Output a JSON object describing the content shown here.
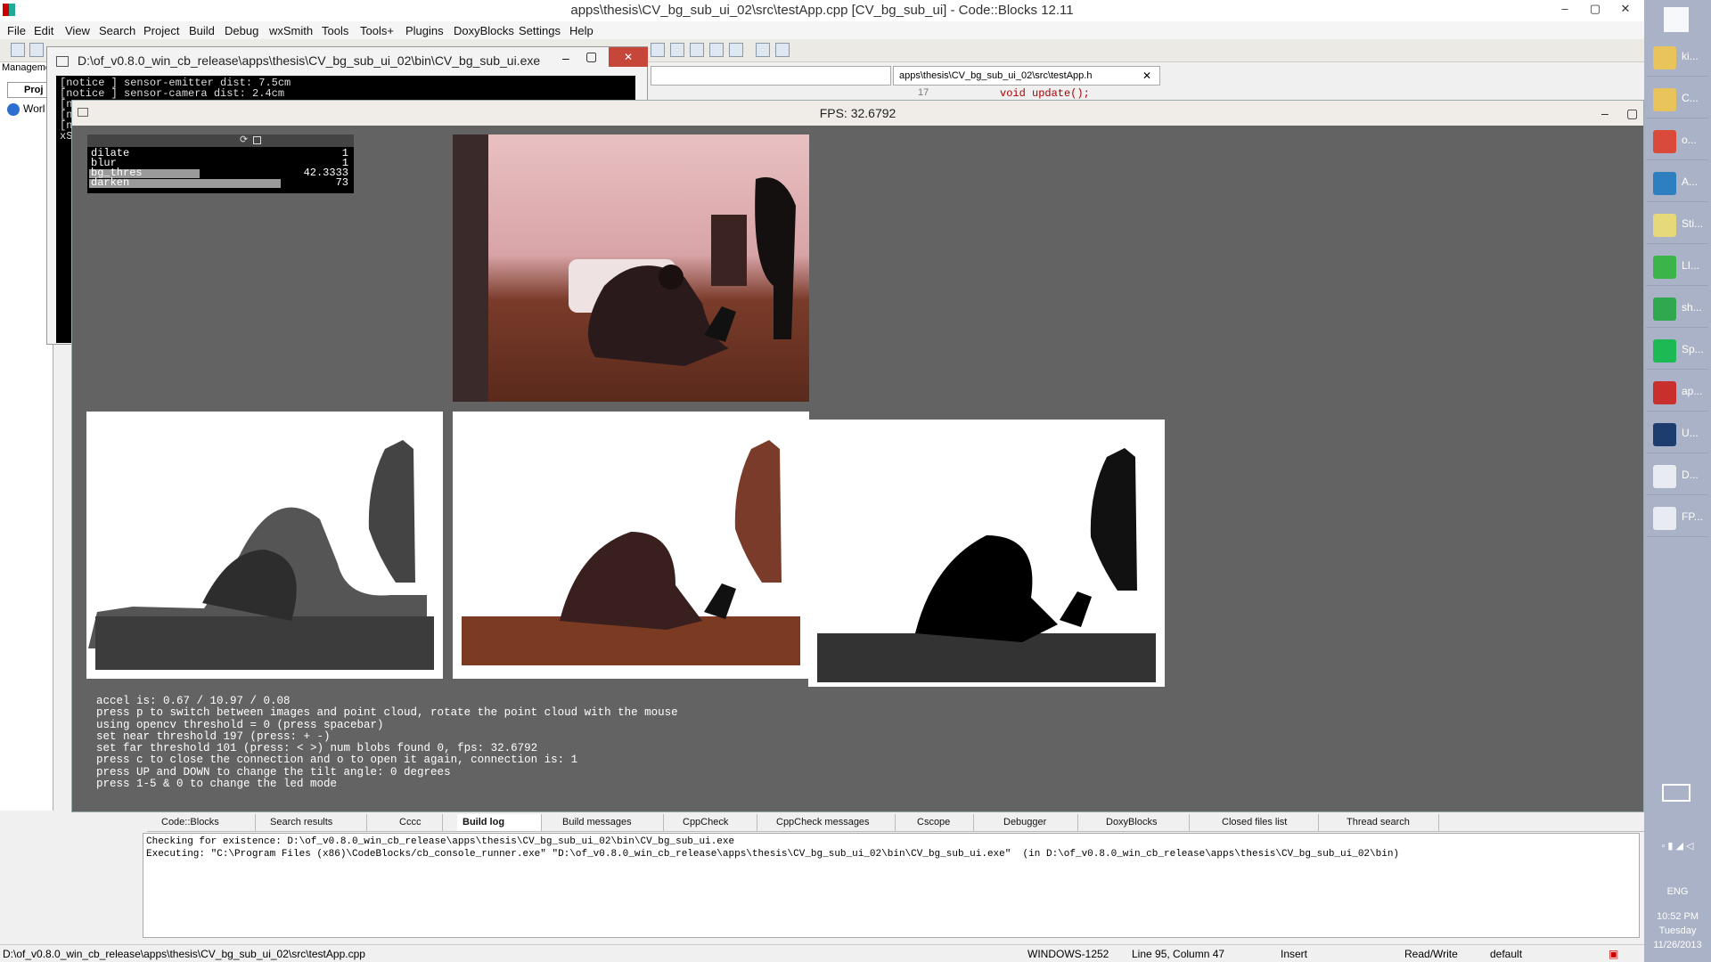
{
  "window": {
    "title": "apps\\thesis\\CV_bg_sub_ui_02\\src\\testApp.cpp [CV_bg_sub_ui] - Code::Blocks 12.11",
    "controls": [
      "–",
      "▢",
      "✕"
    ]
  },
  "menu": [
    "File",
    "Edit",
    "View",
    "Search",
    "Project",
    "Build",
    "Debug",
    "wxSmith",
    "Tools",
    "Tools+",
    "Plugins",
    "DoxyBlocks",
    "Settings",
    "Help"
  ],
  "management": {
    "title": "Manageme",
    "tab": "Proj",
    "root": "Worl"
  },
  "console": {
    "title": "D:\\of_v0.8.0_win_cb_release\\apps\\thesis\\CV_bg_sub_ui_02\\bin\\CV_bg_sub_ui.exe",
    "lines": [
      "[notice ] sensor-emitter dist: 7.5cm",
      "[notice ] sensor-camera dist:  2.4cm",
      "[n",
      "[n",
      "[n",
      "xS"
    ]
  },
  "editor": {
    "tab": "apps\\thesis\\CV_bg_sub_ui_02\\src\\testApp.h",
    "line_no": "17",
    "code": "void update();"
  },
  "ofapp": {
    "fps_title": "FPS: 32.6792",
    "sliders": [
      {
        "label": "dilate",
        "value": "1",
        "fraction": 0.0
      },
      {
        "label": "blur",
        "value": "1",
        "fraction": 0.0
      },
      {
        "label": "bg_thres",
        "value": "42.3333",
        "fraction": 0.42
      },
      {
        "label": "darken",
        "value": "73",
        "fraction": 0.73
      }
    ],
    "info": [
      "accel is: 0.67 / 10.97 / 0.08",
      "press p to switch between images and point cloud, rotate the point cloud with the mouse",
      "using opencv threshold = 0 (press spacebar)",
      "set near threshold 197 (press: + -)",
      "set far threshold 101 (press: < >) num blobs found 0, fps: 32.6792",
      "press c to close the connection and o to open it again, connection is: 1",
      "press UP and DOWN to change the tilt angle: 0 degrees",
      "press 1-5 & 0 to change the led mode"
    ]
  },
  "bottom_tabs": [
    "Code::Blocks",
    "Search results",
    "Cccc",
    "Build log",
    "Build messages",
    "CppCheck",
    "CppCheck messages",
    "Cscope",
    "Debugger",
    "DoxyBlocks",
    "Closed files list",
    "Thread search"
  ],
  "build_log": [
    "Checking for existence: D:\\of_v0.8.0_win_cb_release\\apps\\thesis\\CV_bg_sub_ui_02\\bin\\CV_bg_sub_ui.exe",
    "Executing: \"C:\\Program Files (x86)\\CodeBlocks/cb_console_runner.exe\" \"D:\\of_v0.8.0_win_cb_release\\apps\\thesis\\CV_bg_sub_ui_02\\bin\\CV_bg_sub_ui.exe\"  (in D:\\of_v0.8.0_win_cb_release\\apps\\thesis\\CV_bg_sub_ui_02\\bin)"
  ],
  "status": {
    "path": "D:\\of_v0.8.0_win_cb_release\\apps\\thesis\\CV_bg_sub_ui_02\\src\\testApp.cpp",
    "encoding": "WINDOWS-1252",
    "position": "Line 95, Column 47",
    "mode": "Insert",
    "access": "Read/Write",
    "profile": "default"
  },
  "taskbar": {
    "items": [
      {
        "label": "ki...",
        "icon": "folder-icon",
        "color": "#e8c45a"
      },
      {
        "label": "C...",
        "icon": "folder-icon",
        "color": "#e8c45a"
      },
      {
        "label": "o...",
        "icon": "chrome-icon",
        "color": "#d94a3a"
      },
      {
        "label": "A...",
        "icon": "globe-icon",
        "color": "#2d7fc0"
      },
      {
        "label": "Sti...",
        "icon": "sticky-notes-icon",
        "color": "#e6d979"
      },
      {
        "label": "LI...",
        "icon": "line-icon",
        "color": "#3bb54a"
      },
      {
        "label": "sh...",
        "icon": "contact-icon",
        "color": "#2fa84f"
      },
      {
        "label": "Sp...",
        "icon": "spotify-icon",
        "color": "#1db954"
      },
      {
        "label": "ap...",
        "icon": "codeblocks-icon",
        "color": "#c8302e"
      },
      {
        "label": "U...",
        "icon": "photoshop-icon",
        "color": "#1c3d6e"
      },
      {
        "label": "D...",
        "icon": "window-icon",
        "color": "#e8ecf2"
      },
      {
        "label": "FP...",
        "icon": "window-icon",
        "color": "#e8ecf2"
      }
    ],
    "lang": "ENG",
    "time": "10:52 PM",
    "day": "Tuesday",
    "date": "11/26/2013"
  }
}
